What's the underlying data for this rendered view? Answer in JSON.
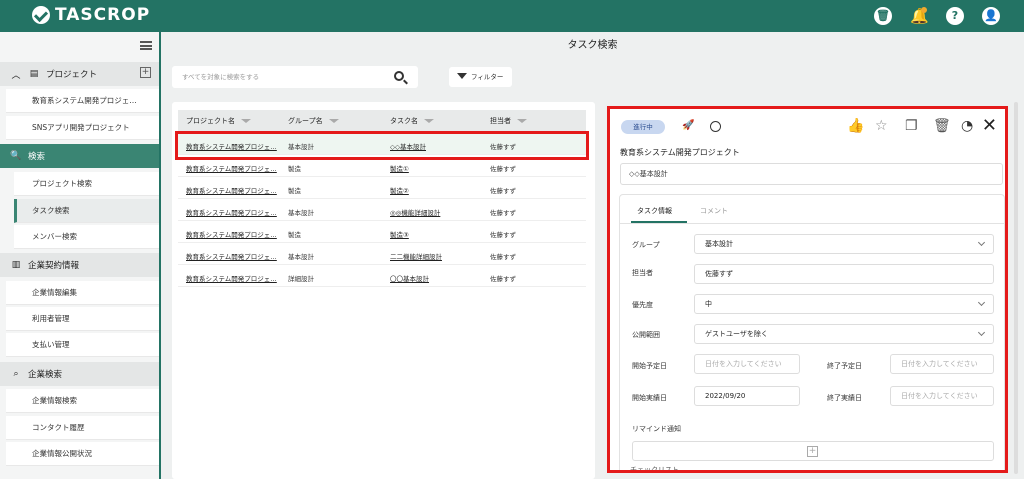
{
  "app": {
    "logo": "TASCROP"
  },
  "topbar": {
    "icons": [
      "trash-icon",
      "bell-icon",
      "help-icon",
      "user-icon"
    ],
    "help_glyph": "?"
  },
  "sidebar": {
    "projects_label": "プロジェクト",
    "projects": [
      "教育系システム開発プロジェ…",
      "SNSアプリ開発プロジェクト"
    ],
    "search_label": "検索",
    "search_items": [
      "プロジェクト検索",
      "タスク検索",
      "メンバー検索"
    ],
    "contract_label": "企業契約情報",
    "contract_items": [
      "企業情報編集",
      "利用者管理",
      "支払い管理"
    ],
    "company_search_label": "企業検索",
    "company_items": [
      "企業情報検索",
      "コンタクト履歴",
      "企業情報公開状況"
    ]
  },
  "page": {
    "title": "タスク検索"
  },
  "search": {
    "placeholder": "すべてを対象に検索をする"
  },
  "filter": {
    "label": "フィルター"
  },
  "table": {
    "headers": [
      "プロジェクト名",
      "グループ名",
      "タスク名",
      "担当者"
    ],
    "rows": [
      {
        "project": "教育系システム開発プロジェ…",
        "group": "基本設計",
        "task": "◇◇基本設計",
        "assignee": "佐藤すず"
      },
      {
        "project": "教育系システム開発プロジェ…",
        "group": "製造",
        "task": "製造①",
        "assignee": "佐藤すず"
      },
      {
        "project": "教育系システム開発プロジェ…",
        "group": "製造",
        "task": "製造②",
        "assignee": "佐藤すず"
      },
      {
        "project": "教育系システム開発プロジェ…",
        "group": "基本設計",
        "task": "◎◎機能詳細設計",
        "assignee": "佐藤すず"
      },
      {
        "project": "教育系システム開発プロジェ…",
        "group": "製造",
        "task": "製造③",
        "assignee": "佐藤すず"
      },
      {
        "project": "教育系システム開発プロジェ…",
        "group": "基本設計",
        "task": "二二機能詳細設計",
        "assignee": "佐藤すず"
      },
      {
        "project": "教育系システム開発プロジェ…",
        "group": "詳細設計",
        "task": "〇〇基本設計",
        "assignee": "佐藤すず"
      }
    ]
  },
  "detail": {
    "status": "進行中",
    "project": "教育系システム開発プロジェクト",
    "task": "◇◇基本設計",
    "tabs": [
      "タスク情報",
      "コメント"
    ],
    "labels": {
      "group": "グループ",
      "assignee": "担当者",
      "priority": "優先度",
      "visibility": "公開範囲",
      "start_plan": "開始予定日",
      "end_plan": "終了予定日",
      "start_actual": "開始実績日",
      "end_actual": "終了実績日",
      "remind": "リマインド通知",
      "checklist": "チェックリスト"
    },
    "values": {
      "group": "基本設計",
      "assignee": "佐藤すず",
      "priority": "中",
      "visibility": "ゲストユーザを除く",
      "start_actual": "2022/09/20"
    },
    "date_placeholder": "日付を入力してください",
    "add_glyph": "+"
  },
  "colors": {
    "brand": "#237364",
    "highlight": "#e41a1a"
  }
}
